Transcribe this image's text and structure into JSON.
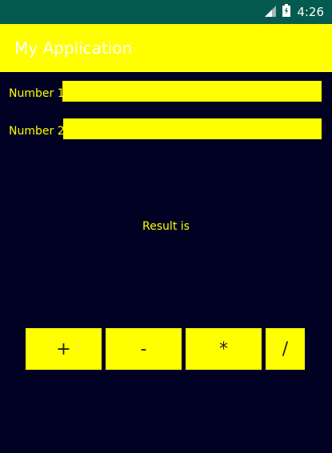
{
  "status_bar": {
    "time": "4:26",
    "icons": [
      "signal-icon",
      "battery-icon"
    ],
    "color": "#055a4f"
  },
  "app_bar": {
    "title": "My Application",
    "color": "#ffff00"
  },
  "form": {
    "number1_label": "Number 1",
    "number1_value": "",
    "number2_label": "Number 2",
    "number2_value": "",
    "result_text": "Result is"
  },
  "buttons": {
    "add": "+",
    "subtract": "-",
    "multiply": "*",
    "divide": "/"
  },
  "colors": {
    "background": "#000022",
    "accent": "#ffff00",
    "button_text": "#222222"
  }
}
